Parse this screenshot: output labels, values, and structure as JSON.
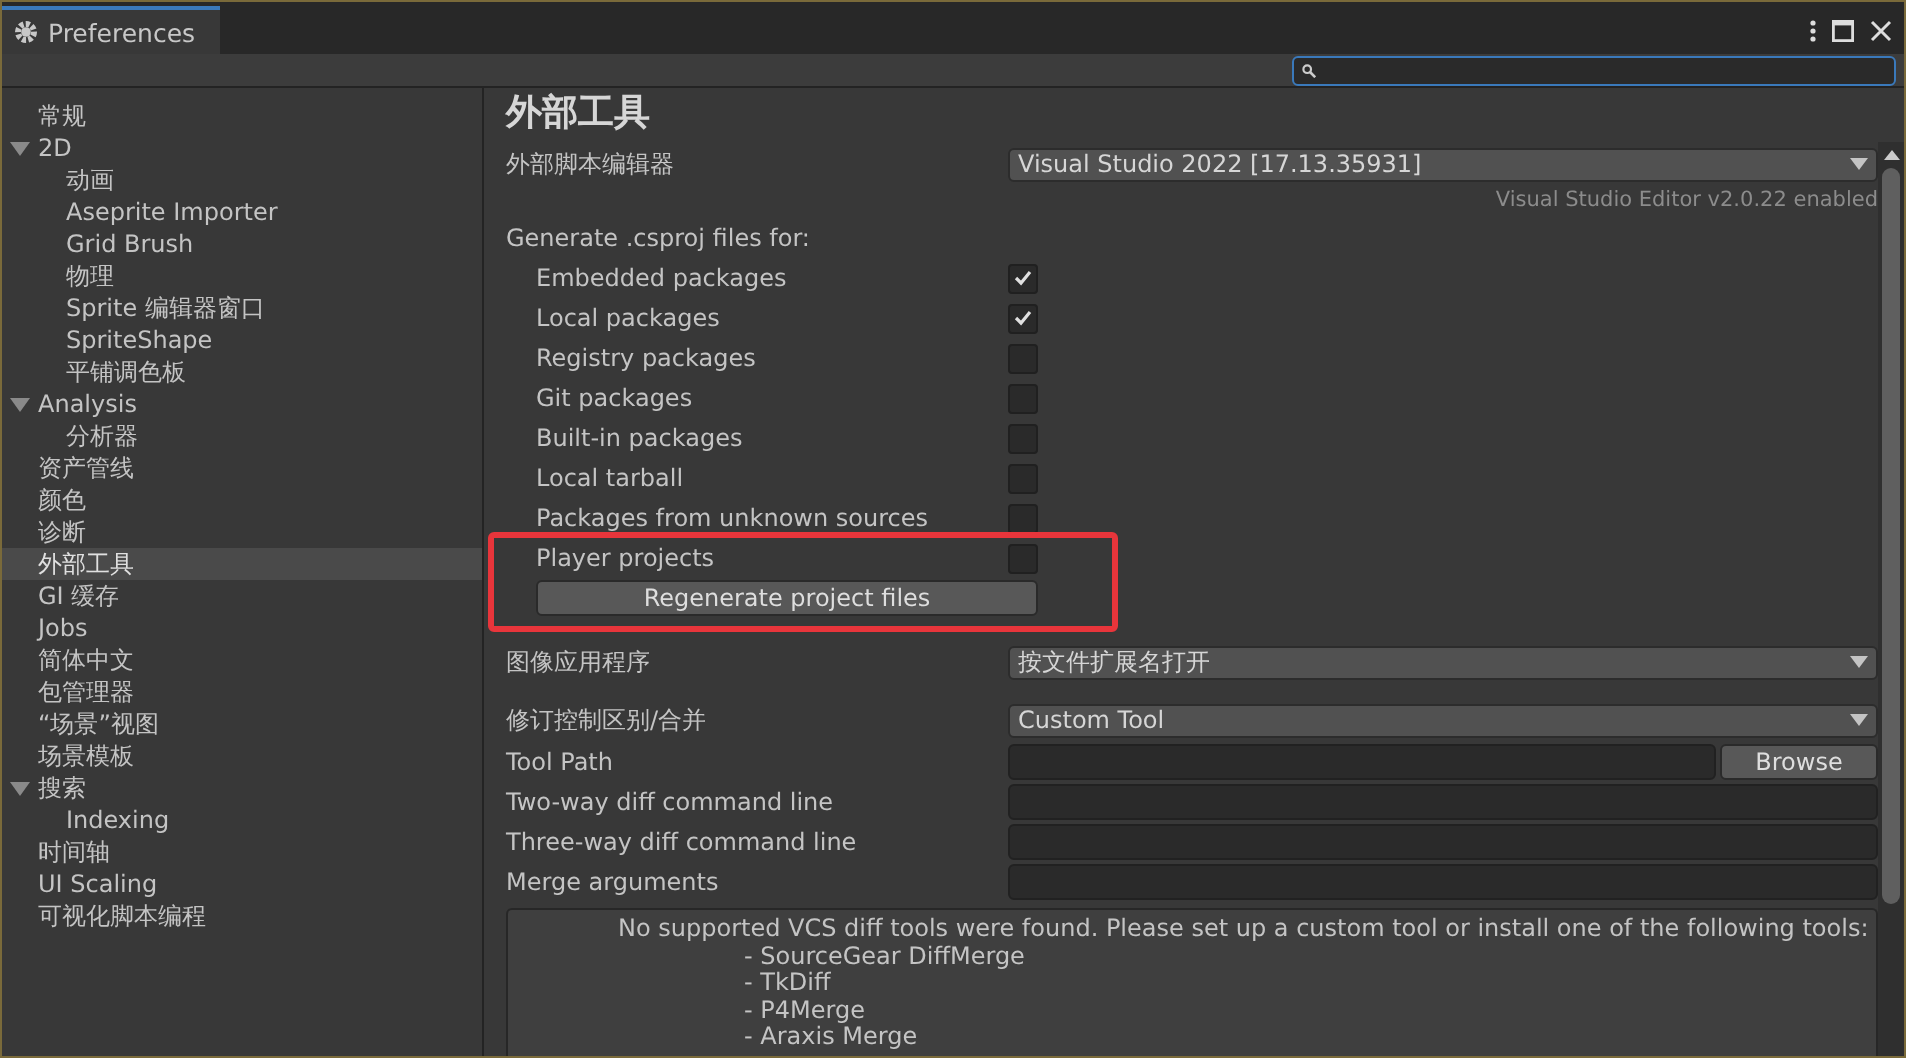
{
  "window": {
    "tab_title": "Preferences"
  },
  "search": {
    "shown": true
  },
  "sidebar": {
    "items": [
      {
        "label": "常规",
        "selected": false
      },
      {
        "label": "2D",
        "selected": false,
        "expanded": true,
        "children": [
          {
            "label": "动画",
            "selected": false
          },
          {
            "label": "Aseprite Importer",
            "selected": false
          },
          {
            "label": "Grid Brush",
            "selected": false
          },
          {
            "label": "物理",
            "selected": false
          },
          {
            "label": "Sprite 编辑器窗口",
            "selected": false
          },
          {
            "label": "SpriteShape",
            "selected": false
          },
          {
            "label": "平铺调色板",
            "selected": false
          }
        ]
      },
      {
        "label": "Analysis",
        "selected": false,
        "expanded": true,
        "children": [
          {
            "label": "分析器",
            "selected": false
          }
        ]
      },
      {
        "label": "资产管线",
        "selected": false
      },
      {
        "label": "颜色",
        "selected": false
      },
      {
        "label": "诊断",
        "selected": false
      },
      {
        "label": "外部工具",
        "selected": true
      },
      {
        "label": "GI 缓存",
        "selected": false
      },
      {
        "label": "Jobs",
        "selected": false
      },
      {
        "label": "简体中文",
        "selected": false
      },
      {
        "label": "包管理器",
        "selected": false
      },
      {
        "label": "“场景”视图",
        "selected": false
      },
      {
        "label": "场景模板",
        "selected": false
      },
      {
        "label": "搜索",
        "selected": false,
        "expanded": true,
        "children": [
          {
            "label": "Indexing",
            "selected": false
          }
        ]
      },
      {
        "label": "时间轴",
        "selected": false
      },
      {
        "label": "UI Scaling",
        "selected": false
      },
      {
        "label": "可视化脚本编程",
        "selected": false
      }
    ]
  },
  "content": {
    "heading": "外部工具",
    "external_editor": {
      "label": "外部脚本编辑器",
      "value": "Visual Studio 2022 [17.13.35931]",
      "note": "Visual Studio Editor v2.0.22 enabled"
    },
    "csproj": {
      "label": "Generate .csproj files for:",
      "options": [
        {
          "label": "Embedded packages",
          "checked": true
        },
        {
          "label": "Local packages",
          "checked": true
        },
        {
          "label": "Registry packages",
          "checked": false
        },
        {
          "label": "Git packages",
          "checked": false
        },
        {
          "label": "Built-in packages",
          "checked": false
        },
        {
          "label": "Local tarball",
          "checked": false
        },
        {
          "label": "Packages from unknown sources",
          "checked": false
        }
      ],
      "highlight": {
        "shown": true,
        "options": [
          {
            "label": "Player projects",
            "checked": false
          }
        ],
        "button": "Regenerate project files"
      }
    },
    "image_app": {
      "label": "图像应用程序",
      "value": "按文件扩展名打开"
    },
    "revision": {
      "label": "修订控制区别/合并",
      "value": "Custom Tool"
    },
    "tool_path": {
      "label": "Tool Path",
      "button": "Browse"
    },
    "fields": [
      {
        "label": "Two-way diff command line"
      },
      {
        "label": "Three-way diff command line"
      },
      {
        "label": "Merge arguments"
      }
    ],
    "help": {
      "message": "No supported VCS diff tools were found. Please set up a custom tool or install one of the following tools:",
      "items": [
        "- SourceGear DiffMerge",
        "- TkDiff",
        "- P4Merge",
        "- Araxis Merge"
      ]
    }
  }
}
